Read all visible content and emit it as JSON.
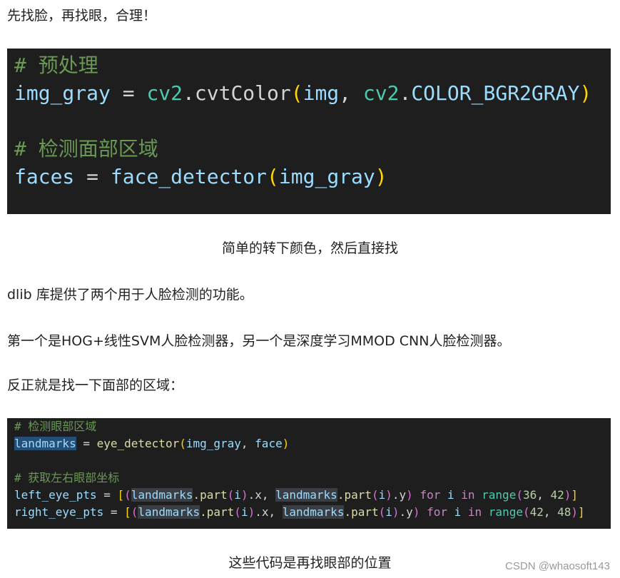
{
  "paragraphs": {
    "p1": "先找脸，再找眼，合理！",
    "p2": "dlib 库提供了两个用于人脸检测的功能。",
    "p3": "第一个是HOG+线性SVM人脸检测器，另一个是深度学习MMOD CNN人脸检测器。",
    "p4": "反正就是找一下面部的区域："
  },
  "captions": {
    "c1": "简单的转下颜色，然后直接找",
    "c2": "这些代码是再找眼部的位置"
  },
  "code1": {
    "l1_comment": "# 预处理",
    "l2": {
      "var": "img_gray",
      "eq": " = ",
      "mod": "cv2",
      "dot": ".",
      "fn": "cvtColor",
      "po": "(",
      "arg": "img",
      "comma": ", ",
      "mod2": "cv2",
      "dot2": ".",
      "const": "COLOR_BGR2GRAY",
      "pc": ")"
    },
    "l4_comment": "# 检测面部区域",
    "l5": {
      "var": "faces",
      "eq": " = ",
      "fn": "face_detector",
      "po": "(",
      "arg": "img_gray",
      "pc": ")"
    }
  },
  "code2": {
    "l1_comment": "# 检测眼部区域",
    "l2": {
      "var": "landmarks",
      "eq": " = ",
      "fn": "eye_detector",
      "po": "(",
      "a1": "img_gray",
      "comma": ", ",
      "a2": "face",
      "pc": ")"
    },
    "l4_comment": "# 获取左右眼部坐标",
    "l5": {
      "var": "left_eye_pts",
      "eq": " = ",
      "ob": "[",
      "op": "(",
      "lm1": "landmarks",
      "p1": ".part",
      "po1": "(",
      "i1": "i",
      "pc1": ")",
      "x": ".x, ",
      "lm2": "landmarks",
      "p2": ".part",
      "po2": "(",
      "i2": "i",
      "pc2": ")",
      "y": ".y",
      "cp": ")",
      "for": " for ",
      "i": "i",
      "in": " in ",
      "range": "range",
      "rpo": "(",
      "n1": "36",
      "rc": ", ",
      "n2": "42",
      "rpc": ")",
      "cb": "]"
    },
    "l6": {
      "var": "right_eye_pts",
      "eq": " = ",
      "ob": "[",
      "op": "(",
      "lm1": "landmarks",
      "p1": ".part",
      "po1": "(",
      "i1": "i",
      "pc1": ")",
      "x": ".x, ",
      "lm2": "landmarks",
      "p2": ".part",
      "po2": "(",
      "i2": "i",
      "pc2": ")",
      "y": ".y",
      "cp": ")",
      "for": " for ",
      "i": "i",
      "in": " in ",
      "range": "range",
      "rpo": "(",
      "n1": "42",
      "rc": ", ",
      "n2": "48",
      "rpc": ")",
      "cb": "]"
    }
  },
  "watermark": "CSDN @whaosoft143"
}
